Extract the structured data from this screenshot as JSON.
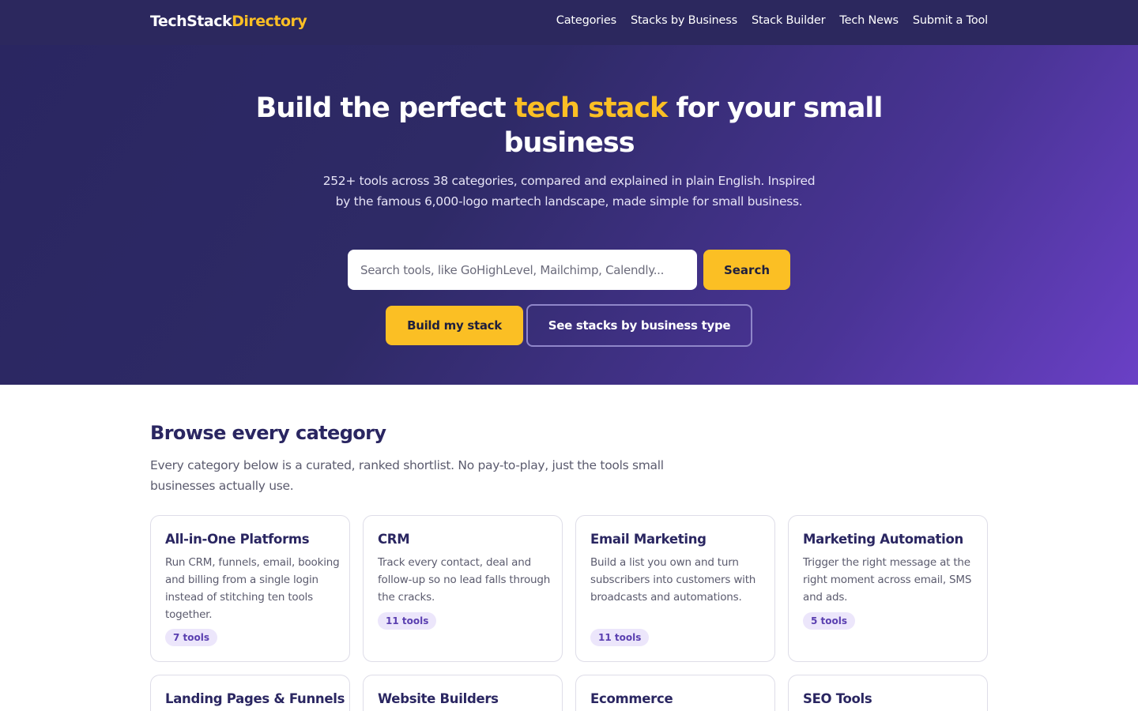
{
  "nav": {
    "logo_main": "TechStack",
    "logo_accent": "Directory",
    "links": [
      "Categories",
      "Stacks by Business",
      "Stack Builder",
      "Tech News",
      "Submit a Tool"
    ]
  },
  "hero": {
    "title_part1": "Build the perfect ",
    "title_accent": "tech stack",
    "title_part2": " for your small business",
    "subtitle": "252+ tools across 38 categories, compared and explained in plain English. Inspired by the famous 6,000-logo martech landscape, made simple for small business.",
    "search_placeholder": "Search tools, like GoHighLevel, Mailchimp, Calendly...",
    "search_button": "Search",
    "primary_button": "Build my stack",
    "secondary_button": "See stacks by business type"
  },
  "categories_section": {
    "title": "Browse every category",
    "subtitle": "Every category below is a curated, ranked shortlist. No pay-to-play, just the tools small businesses actually use.",
    "cards": [
      {
        "title": "All-in-One Platforms",
        "desc": "Run CRM, funnels, email, booking and billing from a single login instead of stitching ten tools together.",
        "count": "7 tools"
      },
      {
        "title": "CRM",
        "desc": "Track every contact, deal and follow-up so no lead falls through the cracks.",
        "count": "11 tools"
      },
      {
        "title": "Email Marketing",
        "desc": "Build a list you own and turn subscribers into customers with broadcasts and automations.",
        "count": "11 tools"
      },
      {
        "title": "Marketing Automation",
        "desc": "Trigger the right message at the right moment across email, SMS and ads.",
        "count": "5 tools"
      },
      {
        "title": "Landing Pages & Funnels",
        "desc": "",
        "count": ""
      },
      {
        "title": "Website Builders",
        "desc": "",
        "count": ""
      },
      {
        "title": "Ecommerce",
        "desc": "",
        "count": ""
      },
      {
        "title": "SEO Tools",
        "desc": "",
        "count": ""
      }
    ]
  },
  "colors": {
    "nav_bg": "#2c285e",
    "accent": "#fbbf24",
    "heading": "#2a2661",
    "badge_bg": "#ece6fb",
    "badge_text": "#5a3fb0"
  }
}
